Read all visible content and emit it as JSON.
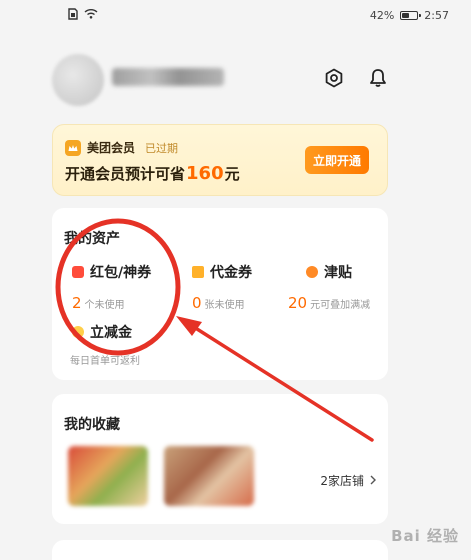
{
  "status_bar": {
    "battery_text": "42%",
    "time": "2:57"
  },
  "header": {
    "avatar_icon": "avatar",
    "username_icon": "blurred-username",
    "settings_icon": "settings-icon",
    "bell_icon": "bell-icon"
  },
  "vip": {
    "name": "美团会员",
    "status": "已过期",
    "line_prefix": "开通会员预计可省",
    "amount": "160",
    "line_suffix": "元",
    "button": "立即开通"
  },
  "assets": {
    "title": "我的资产",
    "items": [
      {
        "label": "红包/神券",
        "number": "2",
        "desc": "个未使用"
      },
      {
        "label": "代金券",
        "number": "0",
        "desc": "张未使用"
      },
      {
        "label": "津贴",
        "number": "20",
        "desc": "元可叠加满减"
      },
      {
        "label": "立减金",
        "number": "",
        "desc": "每日首单可返利"
      }
    ]
  },
  "favorites": {
    "title": "我的收藏",
    "stores": "2家店铺"
  },
  "watermark": "Bai 经验",
  "colors": {
    "accent": "#ff6a00",
    "annotation_red": "#e53226"
  }
}
